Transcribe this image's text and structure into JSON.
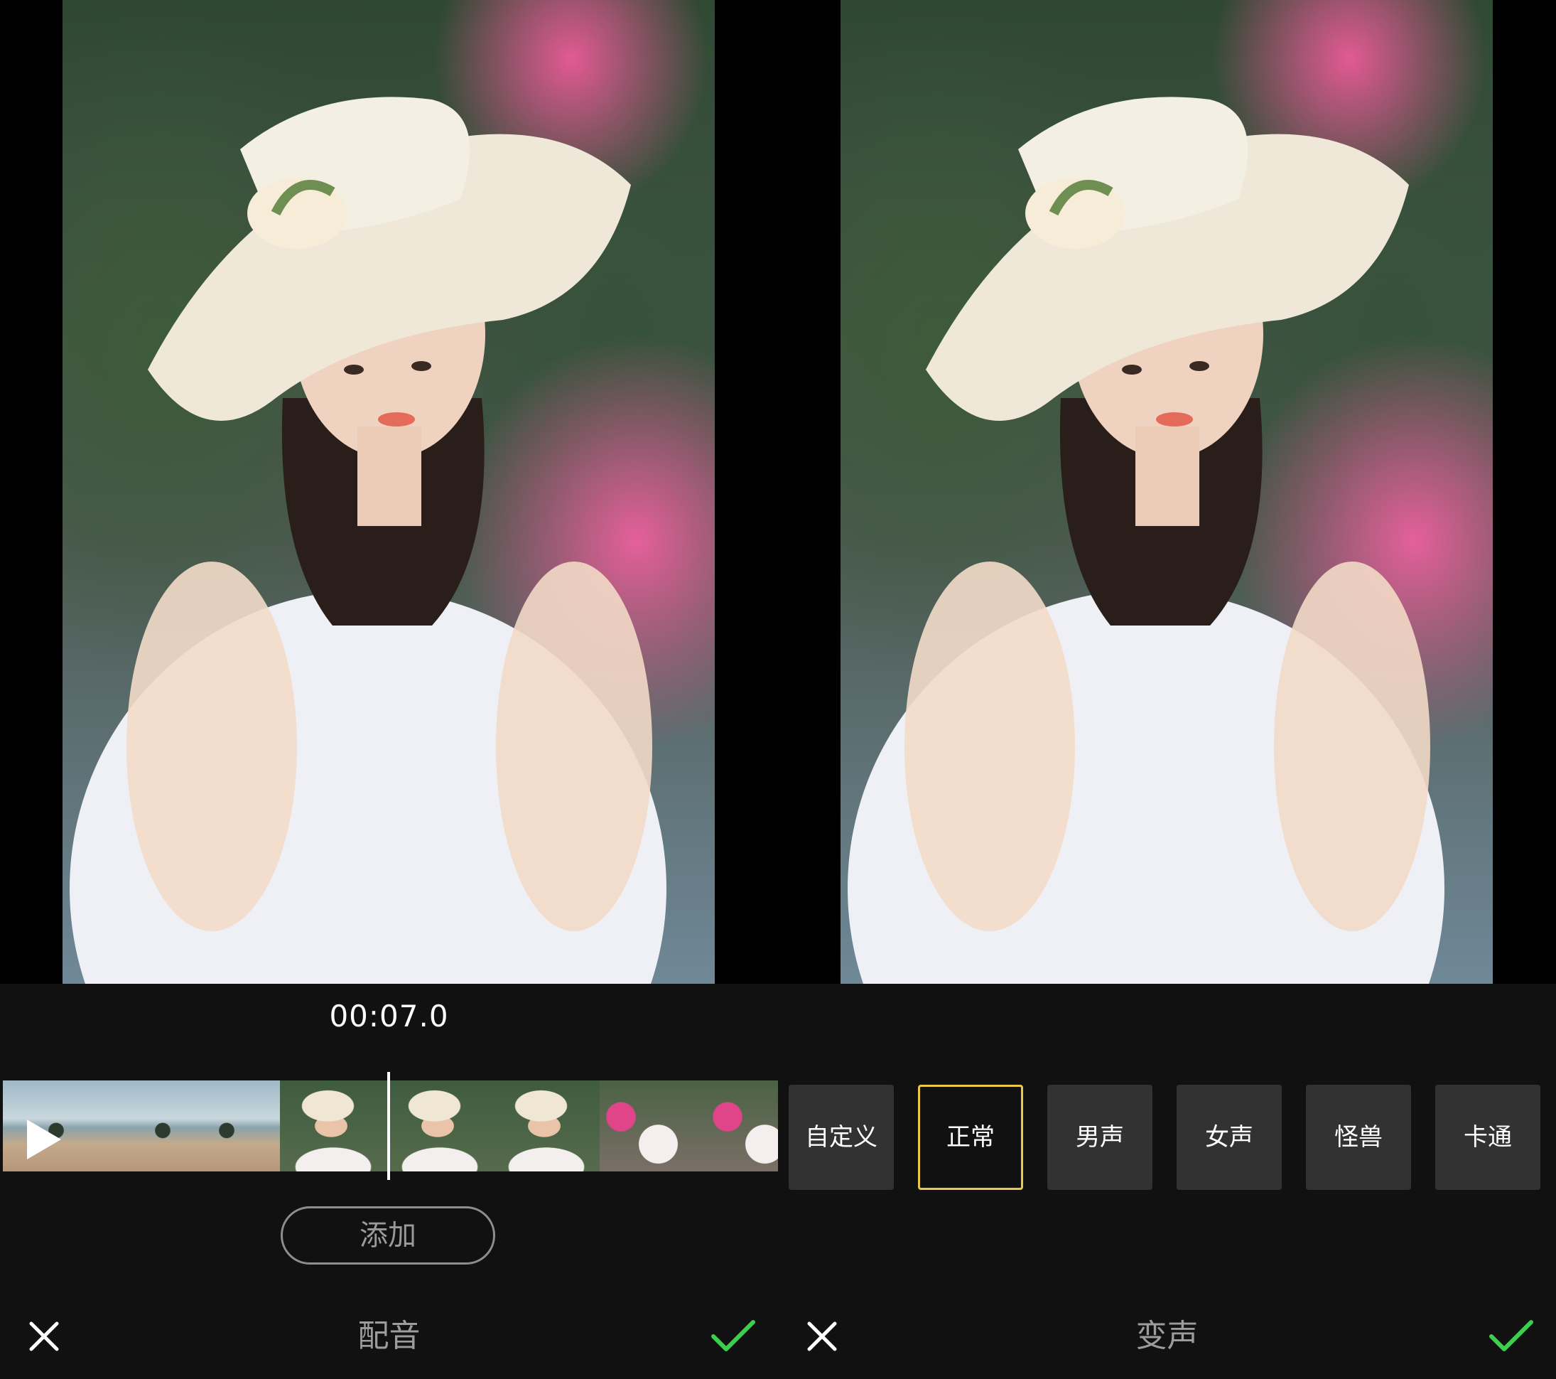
{
  "left": {
    "time": "00:07.0",
    "add_label": "添加",
    "title": "配音",
    "icons": {
      "close": "close-icon",
      "confirm": "check-icon",
      "play": "play-icon"
    }
  },
  "right": {
    "title": "变声",
    "effects": [
      "自定义",
      "正常",
      "男声",
      "女声",
      "怪兽",
      "卡通"
    ],
    "selected_effect": "正常"
  },
  "colors": {
    "background": "#111111",
    "selected_border": "#e9c84a",
    "confirm_green": "#3ccf4e",
    "effect_tile": "#323232"
  }
}
